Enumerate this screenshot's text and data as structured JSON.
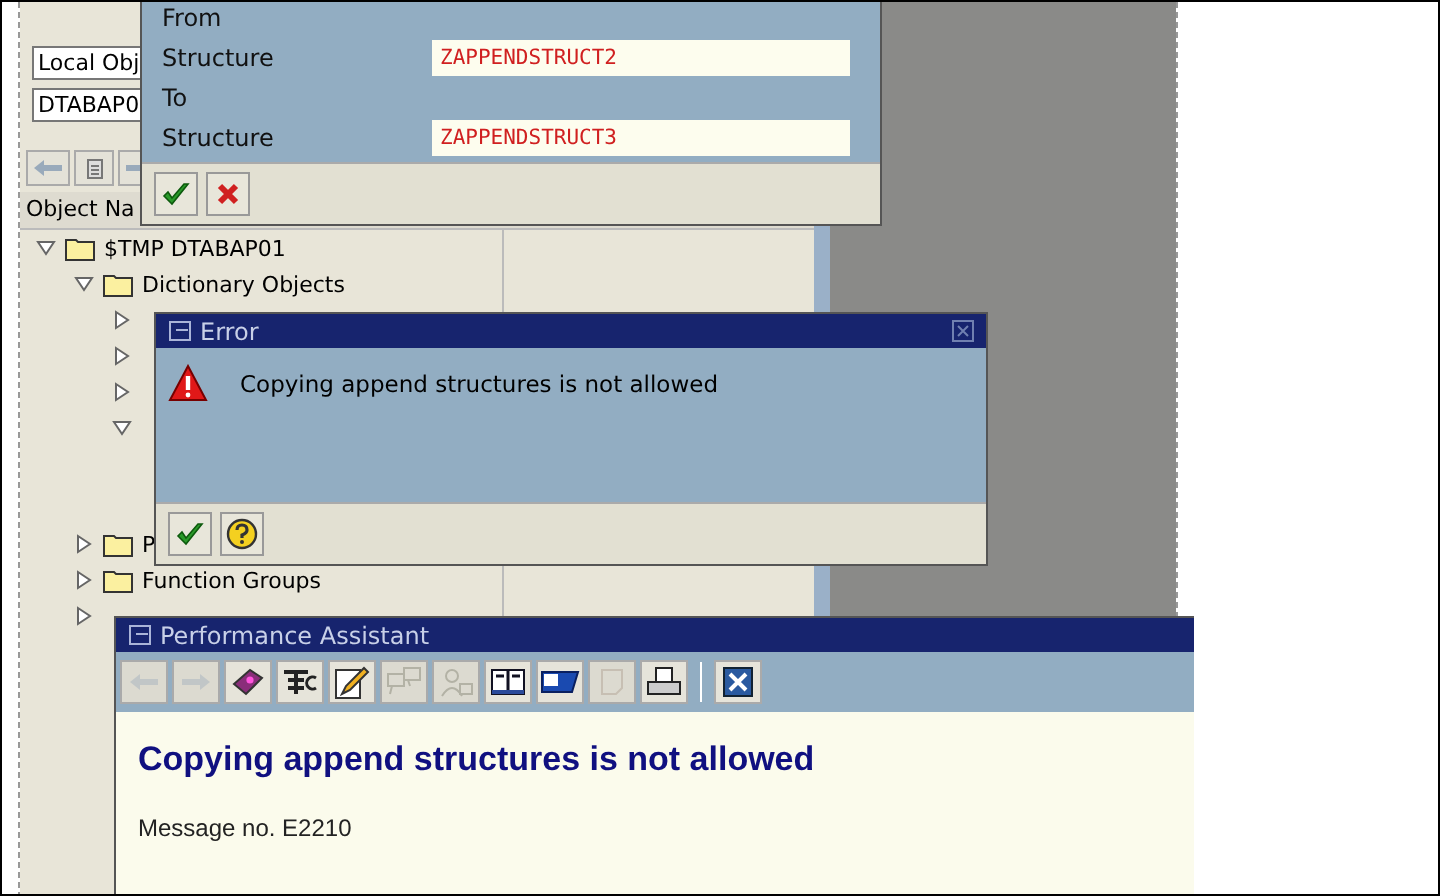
{
  "background_screen": {
    "object_type_field": {
      "value": "Local Obj"
    },
    "object_name_field": {
      "value": "DTABAP0"
    },
    "nav_buttons": [
      {
        "kind": "back"
      },
      {
        "kind": "list"
      },
      {
        "kind": "forward"
      }
    ],
    "tree_header": "Object Na",
    "tree": [
      {
        "label": "$TMP DTABAP01",
        "expanded": true,
        "children": [
          {
            "label": "Dictionary Objects",
            "expanded": true,
            "children": [
              {
                "expanded": false
              },
              {
                "expanded": false
              },
              {
                "expanded": false
              },
              {
                "expanded": true
              }
            ]
          },
          {
            "label": "P",
            "expanded": false
          },
          {
            "label": "Function Groups",
            "expanded": false
          },
          {
            "expanded": false
          }
        ]
      }
    ]
  },
  "copy_dialog": {
    "rows": [
      {
        "kind": "heading",
        "text": "From"
      },
      {
        "kind": "field",
        "label": "Structure",
        "value": "ZAPPENDSTRUCT2"
      },
      {
        "kind": "heading",
        "text": "To"
      },
      {
        "kind": "field",
        "label": "Structure",
        "value": "ZAPPENDSTRUCT3"
      }
    ],
    "buttons": [
      {
        "kind": "confirm"
      },
      {
        "kind": "cancel"
      }
    ]
  },
  "error_dialog": {
    "title": "Error",
    "message": "Copying append structures is not allowed",
    "buttons": [
      {
        "kind": "confirm"
      },
      {
        "kind": "help"
      }
    ]
  },
  "performance_assistant": {
    "title": "Performance Assistant",
    "toolbar": [
      {
        "kind": "back",
        "disabled": true
      },
      {
        "kind": "forward",
        "disabled": true
      },
      {
        "kind": "book",
        "disabled": false
      },
      {
        "kind": "technical",
        "disabled": false
      },
      {
        "kind": "edit",
        "disabled": false
      },
      {
        "kind": "speech",
        "disabled": true
      },
      {
        "kind": "people",
        "disabled": true
      },
      {
        "kind": "open-book",
        "disabled": false
      },
      {
        "kind": "flag",
        "disabled": false
      },
      {
        "kind": "note",
        "disabled": true
      },
      {
        "kind": "print",
        "disabled": false
      },
      {
        "kind": "close",
        "disabled": false
      }
    ],
    "heading": "Copying append structures is not allowed",
    "message_number": "Message no. E2210"
  }
}
